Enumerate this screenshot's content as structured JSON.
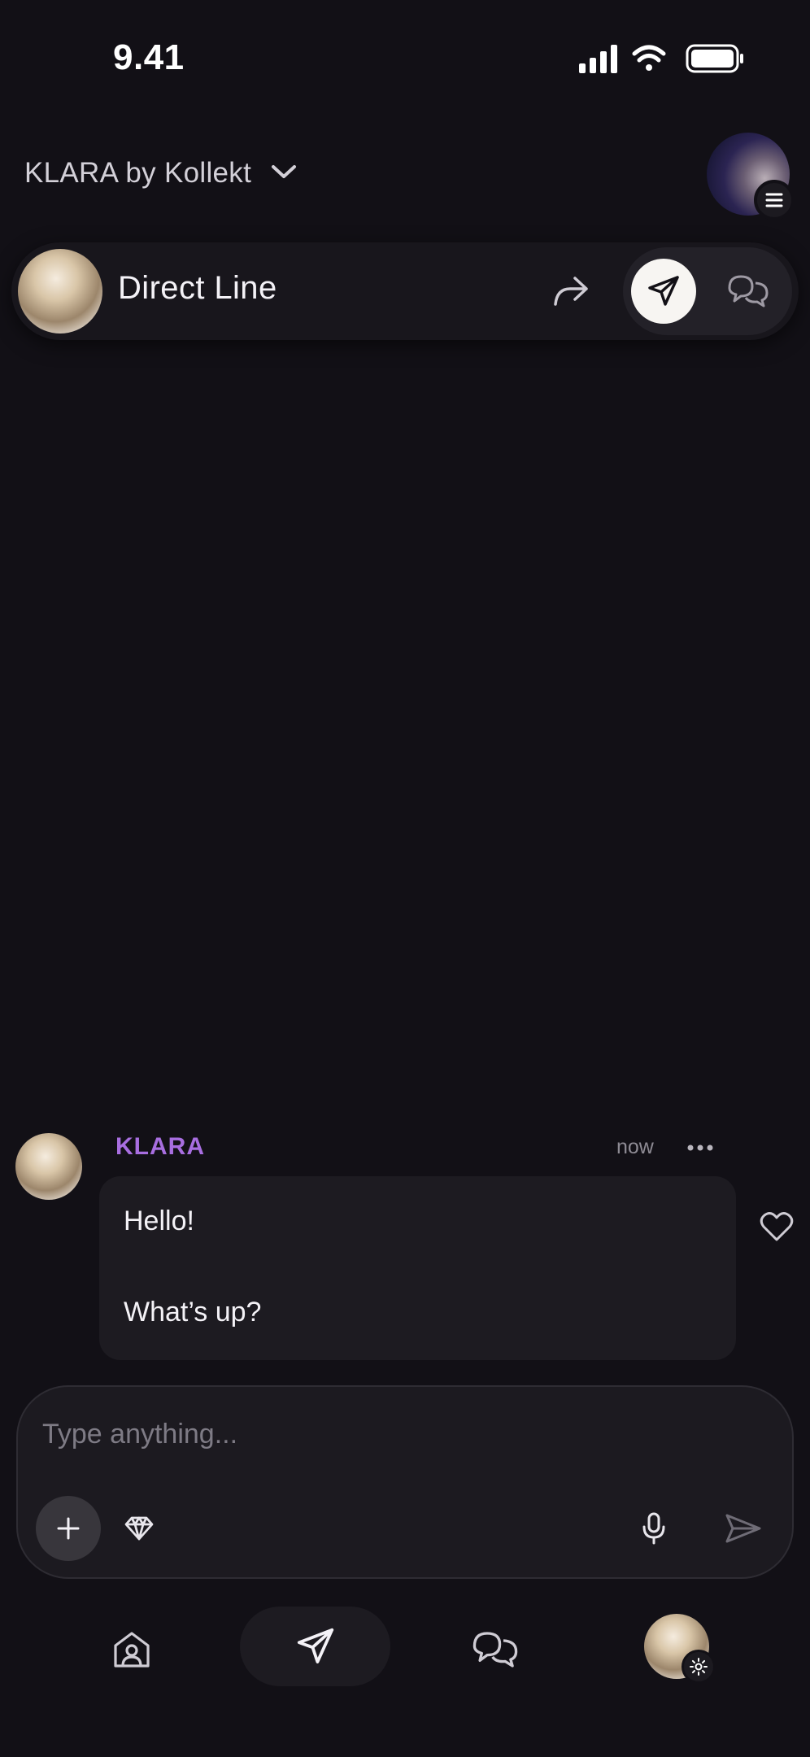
{
  "status_bar": {
    "time": "9.41"
  },
  "header": {
    "app_title": "KLARA by Kollekt",
    "dropdown_icon": "chevron-down-icon",
    "profile_menu_icon": "menu-icon"
  },
  "channel_bar": {
    "title": "Direct Line",
    "share_icon": "share-icon",
    "modes": [
      {
        "name": "direct",
        "icon": "paper-plane-icon",
        "active": true
      },
      {
        "name": "chat",
        "icon": "chat-bubbles-icon",
        "active": false
      }
    ]
  },
  "messages": [
    {
      "sender": "KLARA",
      "time": "now",
      "lines": [
        "Hello!",
        "What’s up?"
      ]
    }
  ],
  "composer": {
    "placeholder": "Type anything..."
  },
  "bottom_nav": {
    "items": [
      "home",
      "direct",
      "chats",
      "profile-settings"
    ]
  },
  "colors": {
    "background": "#121016",
    "sender_accent": "#a86ee0",
    "surface": "#1d1b21"
  }
}
